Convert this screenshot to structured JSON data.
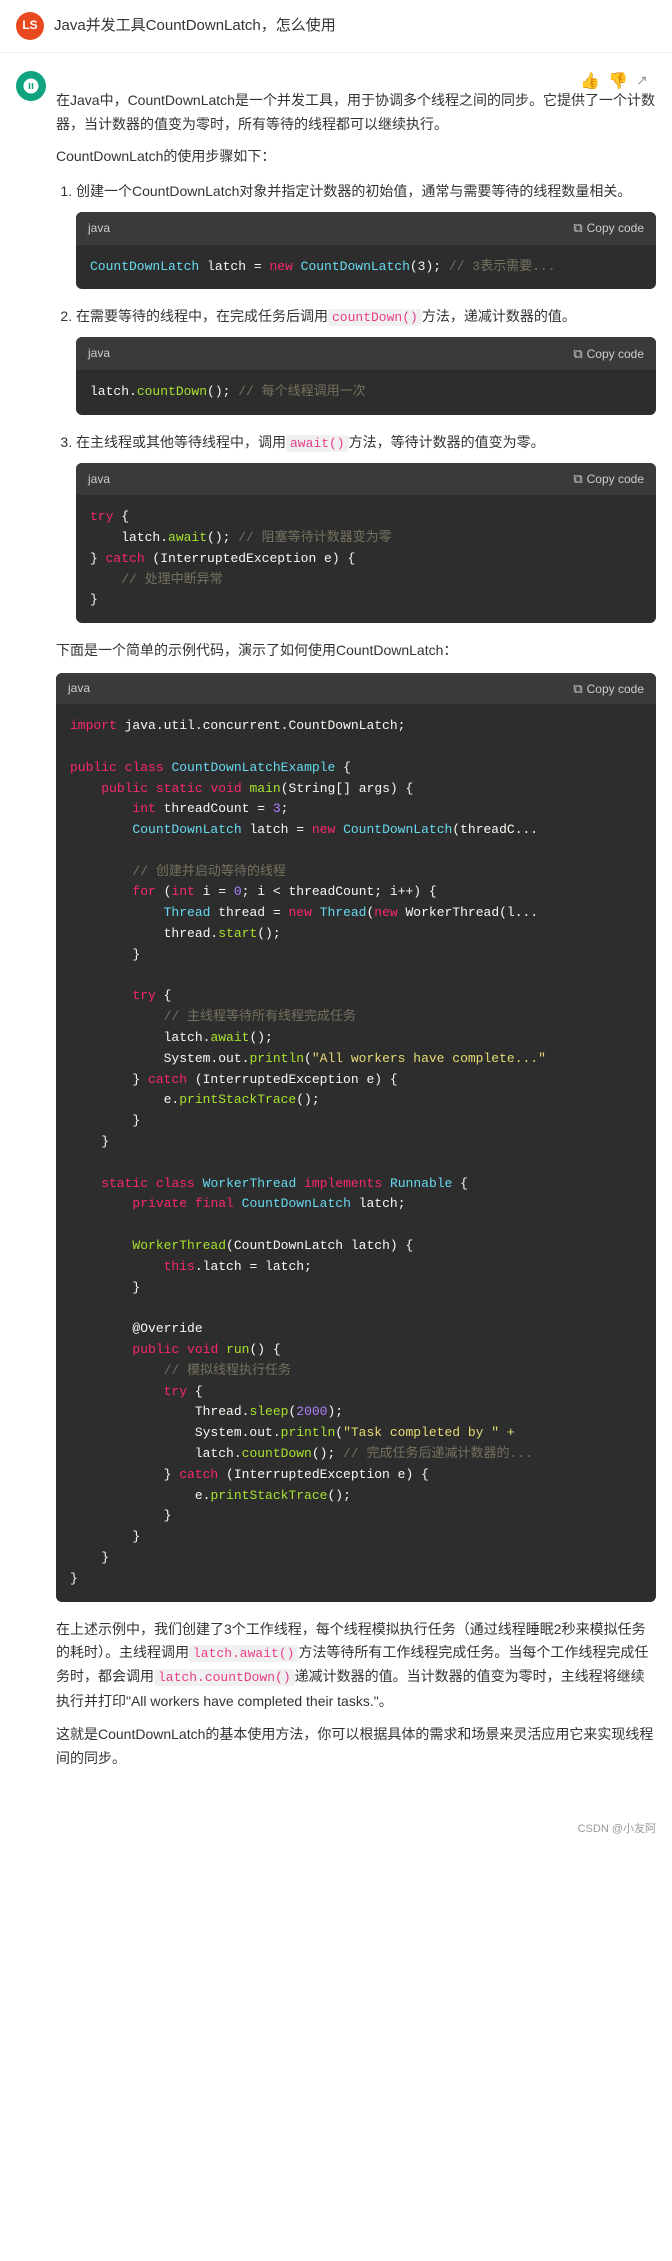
{
  "header": {
    "avatar_text": "LS",
    "title": "Java并发工具CountDownLatch，怎么使用"
  },
  "response": {
    "intro_p1": "在Java中，CountDownLatch是一个并发工具，用于协调多个线程之间的同步。它提供了一个计数器，当计数器的值变为零时，所有等待的线程都可以继续执行。",
    "intro_p2": "CountDownLatch的使用步骤如下：",
    "steps": [
      {
        "text": "创建一个CountDownLatch对象并指定计数器的初始值，通常与需要等待的线程数量相关。",
        "code_lang": "java",
        "code_lines": [
          {
            "parts": [
              {
                "cls": "type",
                "text": "CountDownLatch"
              },
              {
                "cls": "",
                "text": " latch = "
              },
              {
                "cls": "kw",
                "text": "new"
              },
              {
                "cls": " ",
                "text": " "
              },
              {
                "cls": "type",
                "text": "CountDownLatch"
              },
              {
                "cls": "",
                "text": "(3); "
              },
              {
                "cls": "comment",
                "text": "// 3表示需..."
              }
            ]
          }
        ]
      },
      {
        "text": "在需要等待的线程中，在完成任务后调用`countDown()`方法，递减计数器的值。",
        "code_lang": "java",
        "code_lines": [
          {
            "parts": [
              {
                "cls": "",
                "text": "latch."
              },
              {
                "cls": "fn",
                "text": "countDown"
              },
              {
                "cls": "",
                "text": "(); "
              },
              {
                "cls": "comment",
                "text": "// 每个线程调用一次"
              }
            ]
          }
        ]
      },
      {
        "text": "在主线程或其他等待线程中，调用`await()`方法，等待计数器的值变为零。",
        "code_lang": "java",
        "code_lines": [
          {
            "parts": [
              {
                "cls": "kw",
                "text": "try"
              },
              {
                "cls": "",
                "text": " {"
              }
            ]
          },
          {
            "parts": [
              {
                "cls": "",
                "text": "    latch."
              },
              {
                "cls": "fn",
                "text": "await"
              },
              {
                "cls": "",
                "text": "(); "
              },
              {
                "cls": "comment",
                "text": "// 阻塞等待计数器变为零"
              }
            ]
          },
          {
            "parts": [
              {
                "cls": "",
                "text": "} "
              },
              {
                "cls": "kw",
                "text": "catch"
              },
              {
                "cls": "",
                "text": " (InterruptedException e) {"
              }
            ]
          },
          {
            "parts": [
              {
                "cls": "comment",
                "text": "    // 处理中断异常"
              }
            ]
          },
          {
            "parts": [
              {
                "cls": "",
                "text": "}"
              }
            ]
          }
        ]
      }
    ],
    "big_example_intro": "下面是一个简单的示例代码，演示了如何使用CountDownLatch：",
    "big_code_lang": "java",
    "big_code_lines": [
      {
        "parts": [
          {
            "cls": "kw",
            "text": "import"
          },
          {
            "cls": "",
            "text": " java.util.concurrent.CountDownLatch;"
          }
        ]
      },
      {
        "parts": [
          {
            "cls": "",
            "text": ""
          }
        ]
      },
      {
        "parts": [
          {
            "cls": "kw",
            "text": "public"
          },
          {
            "cls": "",
            "text": " "
          },
          {
            "cls": "kw",
            "text": "class"
          },
          {
            "cls": "",
            "text": " "
          },
          {
            "cls": "type",
            "text": "CountDownLatchExample"
          },
          {
            "cls": "",
            "text": " {"
          }
        ]
      },
      {
        "parts": [
          {
            "cls": "",
            "text": "    "
          },
          {
            "cls": "kw",
            "text": "public"
          },
          {
            "cls": "",
            "text": " "
          },
          {
            "cls": "kw",
            "text": "static"
          },
          {
            "cls": "",
            "text": " "
          },
          {
            "cls": "kw",
            "text": "void"
          },
          {
            "cls": "",
            "text": " "
          },
          {
            "cls": "fn",
            "text": "main"
          },
          {
            "cls": "",
            "text": "(String[] args) {"
          }
        ]
      },
      {
        "parts": [
          {
            "cls": "",
            "text": "        "
          },
          {
            "cls": "kw",
            "text": "int"
          },
          {
            "cls": "",
            "text": " threadCount = "
          },
          {
            "cls": "num",
            "text": "3"
          },
          {
            "cls": "",
            "text": ";"
          }
        ]
      },
      {
        "parts": [
          {
            "cls": "",
            "text": "        "
          },
          {
            "cls": "type",
            "text": "CountDownLatch"
          },
          {
            "cls": "",
            "text": " latch = "
          },
          {
            "cls": "kw",
            "text": "new"
          },
          {
            "cls": "",
            "text": " "
          },
          {
            "cls": "type",
            "text": "CountDownLatch"
          },
          {
            "cls": "",
            "text": "(threadC..."
          }
        ]
      },
      {
        "parts": [
          {
            "cls": "",
            "text": ""
          }
        ]
      },
      {
        "parts": [
          {
            "cls": "comment",
            "text": "        // 创建并启动等待的线程"
          }
        ]
      },
      {
        "parts": [
          {
            "cls": "",
            "text": "        "
          },
          {
            "cls": "kw",
            "text": "for"
          },
          {
            "cls": "",
            "text": " ("
          },
          {
            "cls": "kw",
            "text": "int"
          },
          {
            "cls": "",
            "text": " i = "
          },
          {
            "cls": "num",
            "text": "0"
          },
          {
            "cls": "",
            "text": "; i < threadCount; i++) {"
          }
        ]
      },
      {
        "parts": [
          {
            "cls": "",
            "text": "            "
          },
          {
            "cls": "type",
            "text": "Thread"
          },
          {
            "cls": "",
            "text": " thread = "
          },
          {
            "cls": "kw",
            "text": "new"
          },
          {
            "cls": "",
            "text": " "
          },
          {
            "cls": "type",
            "text": "Thread"
          },
          {
            "cls": "",
            "text": "("
          },
          {
            "cls": "kw",
            "text": "new"
          },
          {
            "cls": "",
            "text": " WorkerThread(l..."
          }
        ]
      },
      {
        "parts": [
          {
            "cls": "",
            "text": "            thread."
          },
          {
            "cls": "fn",
            "text": "start"
          },
          {
            "cls": "",
            "text": "();"
          }
        ]
      },
      {
        "parts": [
          {
            "cls": "",
            "text": "        }"
          }
        ]
      },
      {
        "parts": [
          {
            "cls": "",
            "text": ""
          }
        ]
      },
      {
        "parts": [
          {
            "cls": "",
            "text": "        "
          },
          {
            "cls": "kw",
            "text": "try"
          },
          {
            "cls": "",
            "text": " {"
          }
        ]
      },
      {
        "parts": [
          {
            "cls": "comment",
            "text": "            // 主线程等待所有线程完成任务"
          }
        ]
      },
      {
        "parts": [
          {
            "cls": "",
            "text": "            latch."
          },
          {
            "cls": "fn",
            "text": "await"
          },
          {
            "cls": "",
            "text": "();"
          }
        ]
      },
      {
        "parts": [
          {
            "cls": "",
            "text": "            System.out."
          },
          {
            "cls": "fn",
            "text": "println"
          },
          {
            "cls": "",
            "text": "("
          },
          {
            "cls": "str",
            "text": "\"All workers have complete..."
          },
          {
            "cls": "",
            "text": ""
          }
        ]
      },
      {
        "parts": [
          {
            "cls": "",
            "text": "        } "
          },
          {
            "cls": "kw",
            "text": "catch"
          },
          {
            "cls": "",
            "text": " (InterruptedException e) {"
          }
        ]
      },
      {
        "parts": [
          {
            "cls": "",
            "text": "            e."
          },
          {
            "cls": "fn",
            "text": "printStackTrace"
          },
          {
            "cls": "",
            "text": "();"
          }
        ]
      },
      {
        "parts": [
          {
            "cls": "",
            "text": "        }"
          }
        ]
      },
      {
        "parts": [
          {
            "cls": "",
            "text": "    }"
          }
        ]
      },
      {
        "parts": [
          {
            "cls": "",
            "text": ""
          }
        ]
      },
      {
        "parts": [
          {
            "cls": "",
            "text": "    "
          },
          {
            "cls": "kw",
            "text": "static"
          },
          {
            "cls": "",
            "text": " "
          },
          {
            "cls": "kw",
            "text": "class"
          },
          {
            "cls": "",
            "text": " "
          },
          {
            "cls": "type",
            "text": "WorkerThread"
          },
          {
            "cls": "",
            "text": " "
          },
          {
            "cls": "kw",
            "text": "implements"
          },
          {
            "cls": "",
            "text": " "
          },
          {
            "cls": "type",
            "text": "Runnable"
          },
          {
            "cls": "",
            "text": " {"
          }
        ]
      },
      {
        "parts": [
          {
            "cls": "",
            "text": "        "
          },
          {
            "cls": "kw",
            "text": "private"
          },
          {
            "cls": "",
            "text": " "
          },
          {
            "cls": "kw",
            "text": "final"
          },
          {
            "cls": "",
            "text": " "
          },
          {
            "cls": "type",
            "text": "CountDownLatch"
          },
          {
            "cls": "",
            "text": " latch;"
          }
        ]
      },
      {
        "parts": [
          {
            "cls": "",
            "text": ""
          }
        ]
      },
      {
        "parts": [
          {
            "cls": "",
            "text": "        "
          },
          {
            "cls": "fn",
            "text": "WorkerThread"
          },
          {
            "cls": "",
            "text": "(CountDownLatch latch) {"
          }
        ]
      },
      {
        "parts": [
          {
            "cls": "",
            "text": "            "
          },
          {
            "cls": "kw",
            "text": "this"
          },
          {
            "cls": "",
            "text": ".latch = latch;"
          }
        ]
      },
      {
        "parts": [
          {
            "cls": "",
            "text": "        }"
          }
        ]
      },
      {
        "parts": [
          {
            "cls": "",
            "text": ""
          }
        ]
      },
      {
        "parts": [
          {
            "cls": "",
            "text": "        @Override"
          }
        ]
      },
      {
        "parts": [
          {
            "cls": "",
            "text": "        "
          },
          {
            "cls": "kw",
            "text": "public"
          },
          {
            "cls": "",
            "text": " "
          },
          {
            "cls": "kw",
            "text": "void"
          },
          {
            "cls": "",
            "text": " "
          },
          {
            "cls": "fn",
            "text": "run"
          },
          {
            "cls": "",
            "text": "() {"
          }
        ]
      },
      {
        "parts": [
          {
            "cls": "comment",
            "text": "            // 模拟线程执行任务"
          }
        ]
      },
      {
        "parts": [
          {
            "cls": "",
            "text": "            "
          },
          {
            "cls": "kw",
            "text": "try"
          },
          {
            "cls": "",
            "text": " {"
          }
        ]
      },
      {
        "parts": [
          {
            "cls": "",
            "text": "                Thread."
          },
          {
            "cls": "fn",
            "text": "sleep"
          },
          {
            "cls": "",
            "text": "("
          },
          {
            "cls": "num",
            "text": "2000"
          },
          {
            "cls": "",
            "text": ");"
          }
        ]
      },
      {
        "parts": [
          {
            "cls": "",
            "text": "                System.out."
          },
          {
            "cls": "fn",
            "text": "println"
          },
          {
            "cls": "",
            "text": "("
          },
          {
            "cls": "str",
            "text": "\"Task completed by \" +"
          },
          {
            "cls": "",
            "text": ""
          }
        ]
      },
      {
        "parts": [
          {
            "cls": "",
            "text": "                latch."
          },
          {
            "cls": "fn",
            "text": "countDown"
          },
          {
            "cls": "",
            "text": "(); "
          },
          {
            "cls": "comment",
            "text": "// 完成任务后递减计数器的..."
          }
        ]
      },
      {
        "parts": [
          {
            "cls": "",
            "text": "            } "
          },
          {
            "cls": "kw",
            "text": "catch"
          },
          {
            "cls": "",
            "text": " (InterruptedException e) {"
          }
        ]
      },
      {
        "parts": [
          {
            "cls": "",
            "text": "                e."
          },
          {
            "cls": "fn",
            "text": "printStackTrace"
          },
          {
            "cls": "",
            "text": "();"
          }
        ]
      },
      {
        "parts": [
          {
            "cls": "",
            "text": "            }"
          }
        ]
      },
      {
        "parts": [
          {
            "cls": "",
            "text": "        }"
          }
        ]
      },
      {
        "parts": [
          {
            "cls": "",
            "text": "    }"
          }
        ]
      },
      {
        "parts": [
          {
            "cls": "",
            "text": "}"
          }
        ]
      }
    ],
    "summary_p1": "在上述示例中，我们创建了3个工作线程，每个线程模拟执行任务（通过线程睡眠2秒来模拟任务的耗时）。主线程调用`latch.await()`方法等待所有工作线程完成任务。当每个工作线程完成任务时，都会调用`latch.countDown()`递减计数器的值。当计数器的值变为零时，主线程将继续执行并打印\"All workers have completed their tasks.\"。",
    "summary_p2": "这就是CountDownLatch的基本使用方法，你可以根据具体的需求和场景来灵活应用它来实现线程间的同步。",
    "footer": "CSDN @小友阿"
  },
  "buttons": {
    "copy": "Copy code",
    "thumbup": "👍",
    "thumbdown": "👎",
    "share": "↗"
  },
  "icons": {
    "copy": "⧉",
    "ai": "✦"
  }
}
